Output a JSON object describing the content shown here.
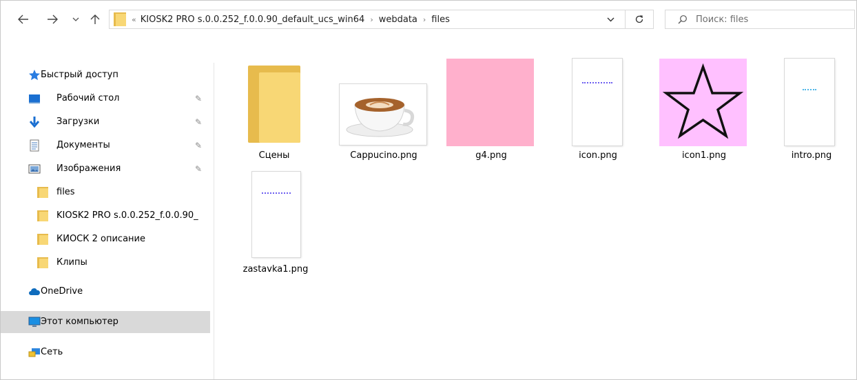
{
  "address": {
    "prefix": "«",
    "crumbs": [
      "KIOSK2 PRO s.0.0.252_f.0.0.90_default_ucs_win64",
      "webdata",
      "files"
    ],
    "separator": "›"
  },
  "search": {
    "placeholder": "Поиск: files"
  },
  "sidebar": {
    "items": [
      {
        "label": "Быстрый доступ",
        "icon": "star-icon"
      },
      {
        "label": "Рабочий стол",
        "icon": "desktop-icon",
        "pinned": true
      },
      {
        "label": "Загрузки",
        "icon": "download-arrow-icon",
        "pinned": true
      },
      {
        "label": "Документы",
        "icon": "document-icon",
        "pinned": true
      },
      {
        "label": "Изображения",
        "icon": "pictures-icon",
        "pinned": true
      },
      {
        "label": "files",
        "icon": "folder-icon"
      },
      {
        "label": "KIOSK2 PRO s.0.0.252_f.0.0.90_",
        "icon": "folder-icon"
      },
      {
        "label": "КИОСК 2 описание",
        "icon": "folder-icon"
      },
      {
        "label": "Клипы",
        "icon": "folder-icon"
      },
      {
        "label": "OneDrive",
        "icon": "cloud-icon"
      },
      {
        "label": "Этот компьютер",
        "icon": "computer-icon",
        "selected": true
      },
      {
        "label": "Сеть",
        "icon": "network-icon"
      }
    ]
  },
  "files": [
    {
      "name": "Сцены",
      "kind": "folder"
    },
    {
      "name": "Cappucino.png",
      "kind": "image"
    },
    {
      "name": "g4.png",
      "kind": "image",
      "color": "#ffb0cc"
    },
    {
      "name": "icon.png",
      "kind": "image"
    },
    {
      "name": "icon1.png",
      "kind": "image",
      "color": "#ffc0ff"
    },
    {
      "name": "intro.png",
      "kind": "image"
    },
    {
      "name": "zastavka1.png",
      "kind": "image"
    }
  ],
  "colors": {
    "selected_bg": "#d9d9d9",
    "folder": "#f8d775",
    "accent": "#0078d7"
  }
}
